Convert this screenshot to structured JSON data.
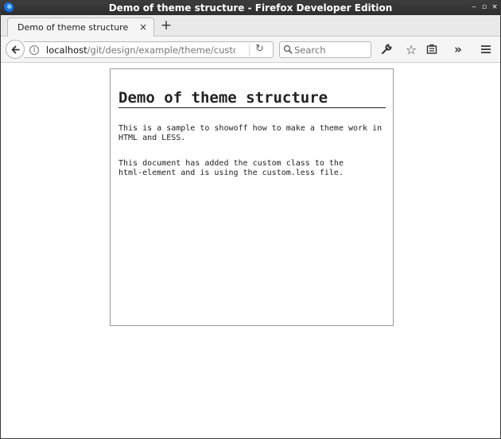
{
  "window": {
    "title": "Demo of theme structure - Firefox Developer Edition",
    "controls": {
      "minimize": "‒",
      "maximize": "▫",
      "close": "×"
    }
  },
  "tabs": [
    {
      "label": "Demo of theme structure",
      "close": "×"
    }
  ],
  "new_tab_label": "+",
  "navbar": {
    "url_host": "localhost",
    "url_path": "/git/design/example/theme/custom",
    "search_placeholder": "Search",
    "icons": [
      "back-arrow-icon",
      "info-icon",
      "reload-icon",
      "search-icon",
      "wrench-icon",
      "star-icon",
      "library-icon",
      "overflow-chevron-icon",
      "hamburger-menu-icon"
    ],
    "overflow_label": "»"
  },
  "page": {
    "heading": "Demo of theme structure",
    "paragraphs": [
      "This is a sample to showoff how to make a theme work in\nHTML and LESS.",
      "This document has added the custom class to the\nhtml-element and is using the custom.less file."
    ]
  }
}
